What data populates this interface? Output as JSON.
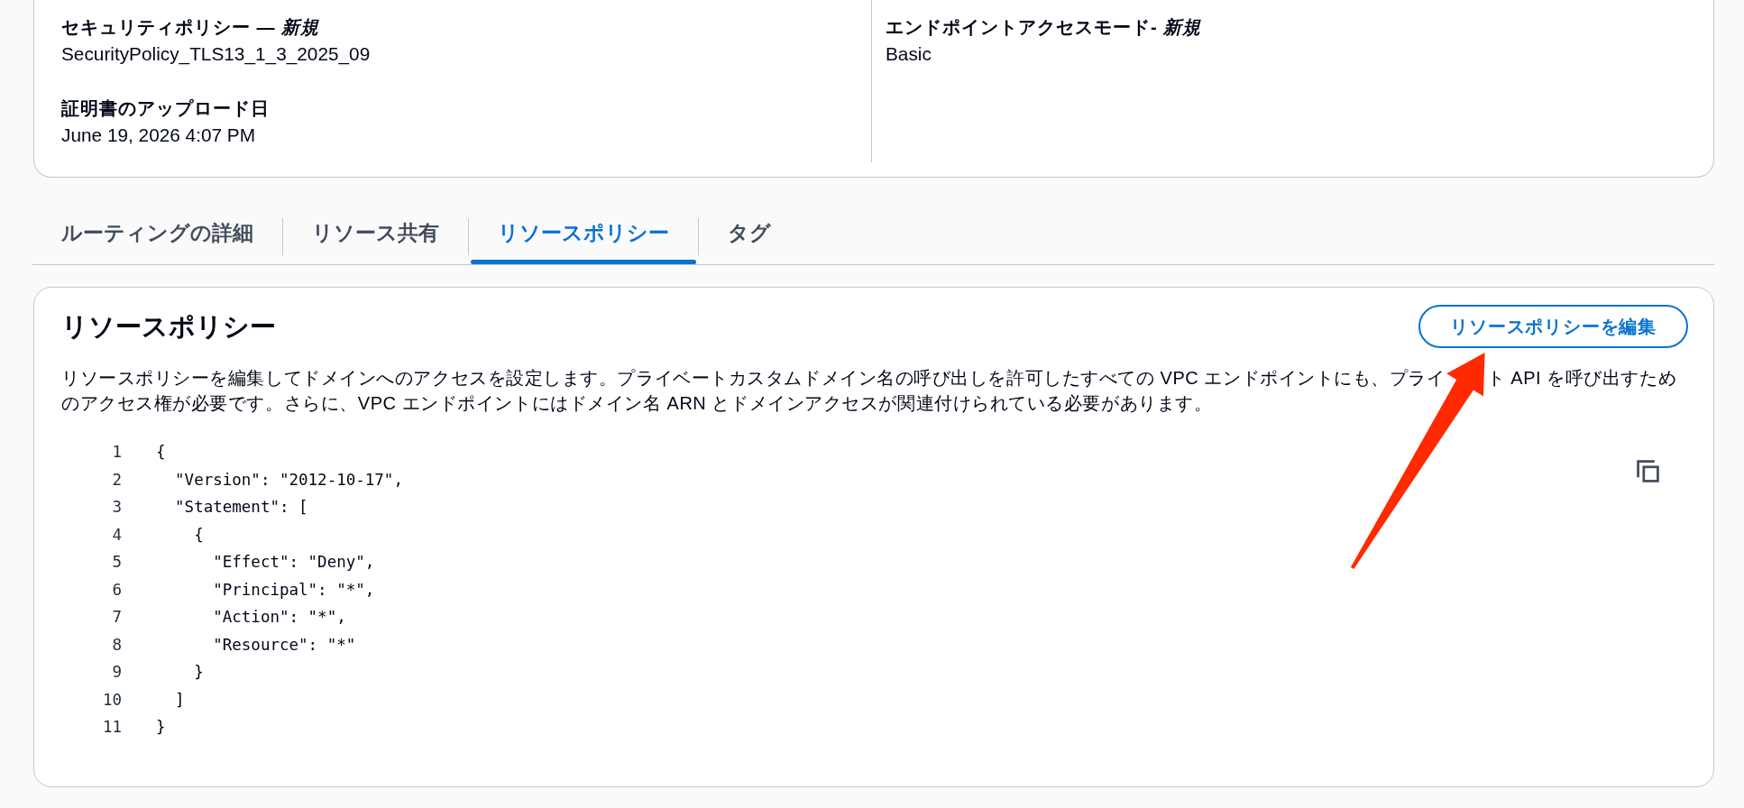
{
  "details": {
    "columns": [
      {
        "fields": [
          {
            "label": "セキュリティポリシー — *新規*",
            "value": "SecurityPolicy_TLS13_1_3_2025_09"
          },
          {
            "label": "証明書のアップロード日",
            "value": "June 19, 2026 4:07 PM"
          }
        ]
      },
      {
        "fields": [
          {
            "label": "エンドポイントアクセスモード- *新規*",
            "value": "Basic"
          }
        ]
      }
    ]
  },
  "tabs": [
    {
      "label": "ルーティングの詳細",
      "selected": false
    },
    {
      "label": "リソース共有",
      "selected": false
    },
    {
      "label": "リソースポリシー",
      "selected": true
    },
    {
      "label": "タグ",
      "selected": false
    }
  ],
  "resource_policy": {
    "title": "リソースポリシー",
    "edit_button": "リソースポリシーを編集",
    "description": [
      "リソースポリシーを編集してドメインへのアクセスを設定します。プライベートカスタムドメイン名の呼び出しを許可したすべての VPC エンドポイントにも、プライ",
      "ト API を呼び出すためのアクセス権が必要です。さらに、VPC エンドポイントにはドメイン名 ARN とドメインアクセスが関連付けられている必要があります。"
    ],
    "code": [
      {
        "number": "1",
        "text": "{"
      },
      {
        "number": "2",
        "text": "  \"Version\": \"2012-10-17\","
      },
      {
        "number": "3",
        "text": "  \"Statement\": ["
      },
      {
        "number": "4",
        "text": "    {"
      },
      {
        "number": "5",
        "text": "      \"Effect\": \"Deny\","
      },
      {
        "number": "6",
        "text": "      \"Principal\": \"*\","
      },
      {
        "number": "7",
        "text": "      \"Action\": \"*\","
      },
      {
        "number": "8",
        "text": "      \"Resource\": \"*\""
      },
      {
        "number": "9",
        "text": "    }"
      },
      {
        "number": "10",
        "text": "  ]"
      },
      {
        "number": "11",
        "text": "}"
      }
    ]
  }
}
